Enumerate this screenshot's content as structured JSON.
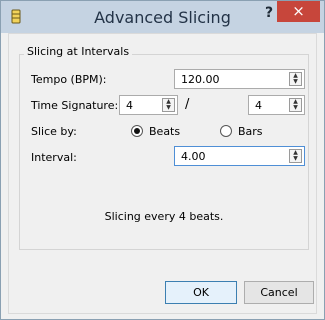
{
  "window": {
    "title": "Advanced Slicing",
    "help_label": "?",
    "close_label": "×"
  },
  "group": {
    "title": "Slicing at Intervals"
  },
  "fields": {
    "tempo": {
      "label": "Tempo (BPM):",
      "value": "120.00"
    },
    "time_signature": {
      "label": "Time Signature:",
      "numerator": "4",
      "separator": "/",
      "denominator": "4"
    },
    "slice_by": {
      "label": "Slice by:",
      "options": [
        {
          "label": "Beats",
          "selected": true
        },
        {
          "label": "Bars",
          "selected": false
        }
      ]
    },
    "interval": {
      "label": "Interval:",
      "value": "4.00"
    }
  },
  "status_text": "Slicing every 4 beats.",
  "buttons": {
    "ok": "OK",
    "cancel": "Cancel"
  },
  "icons": {
    "app": "bucket-icon",
    "spin_up": "up-arrow-icon",
    "spin_down": "down-arrow-icon"
  }
}
